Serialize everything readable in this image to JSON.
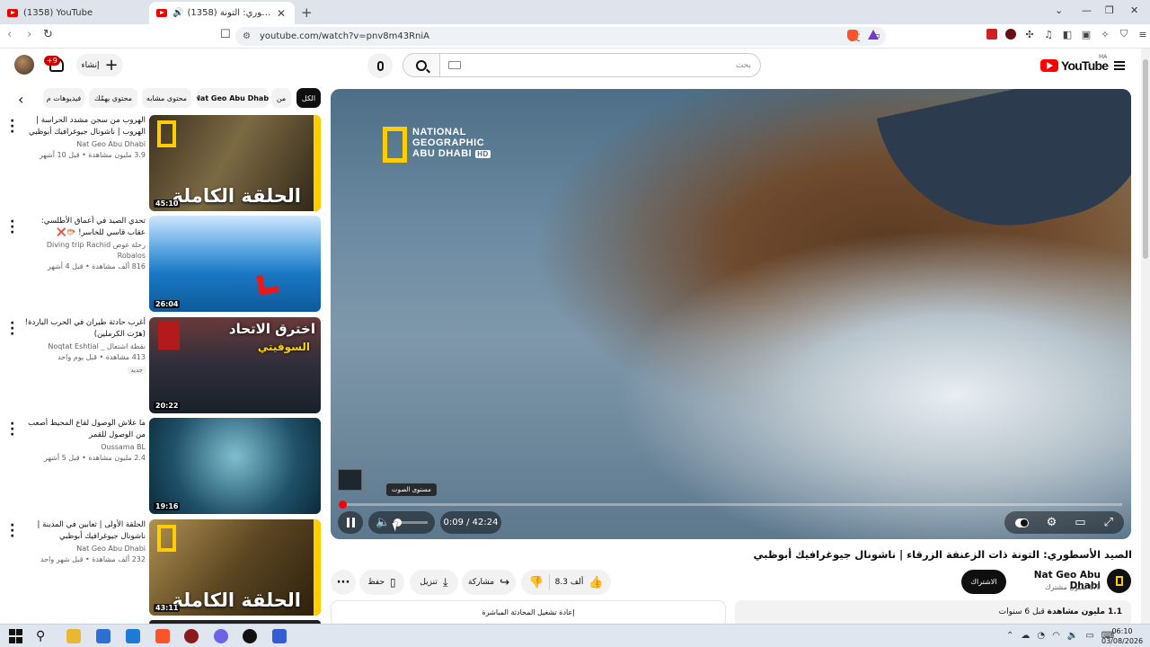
{
  "browser": {
    "tabs": [
      {
        "title": "(1358) YouTube",
        "active": false
      },
      {
        "title": "(1358) الصيد الأسطوري: التونة",
        "active": true
      }
    ],
    "url": "youtube.com/watch?v=pnv8m43RniA"
  },
  "header": {
    "notifications_badge": "+9",
    "create_label": "إنشاء",
    "search_placeholder": "بحث",
    "logo_text": "YouTube",
    "country_code": "MA"
  },
  "chips": [
    {
      "label": "الكل",
      "selected": true
    },
    {
      "label": "من",
      "selected": false
    },
    {
      "label": "Nat Geo Abu Dhabi",
      "selected": false
    },
    {
      "label": "محتوى مشابه",
      "selected": false
    },
    {
      "label": "محتوى يهمّك",
      "selected": false
    },
    {
      "label": "فيديوهات م",
      "selected": false
    }
  ],
  "suggestions": [
    {
      "title": "الهروب من سجن مشدد الحراسة | الهروب | ناشونال جيوغرافيك أبوظبي",
      "channel": "Nat Geo Abu Dhabi",
      "views": "3.9 مليون مشاهدة • قبل 10 أشهر",
      "duration": "45:10",
      "thumb_caption": "الحلقة الكاملة",
      "badge": ""
    },
    {
      "title": "تحدي الصيد في أعماق الأطلسي: عقاب قاسي للخاسر! 🐡❌",
      "channel": "رحلة غوص Diving trip Rachid Robalos",
      "views": "816 ألف مشاهدة • قبل 4 أشهر",
      "duration": "26:04",
      "thumb_caption": "",
      "badge": ""
    },
    {
      "title": "أغرب حادثة طيران في الحرب الباردة! (هرّت الكرملين)",
      "channel": "نقطة اشتعال _ Noqtat Eshtial",
      "views": "413 مشاهدة • قبل يوم واحد",
      "duration": "20:22",
      "thumb_caption": "اخترق الاتحاد",
      "thumb_caption2": "السوفيتي",
      "badge": "جديد"
    },
    {
      "title": "ما علاش الوصول لقاع المحيط أصعب من الوصول للقمر",
      "channel": "Oussama BL",
      "views": "2.4 مليون مشاهدة • قبل 5 أشهر",
      "duration": "19:16",
      "thumb_caption": "",
      "badge": ""
    },
    {
      "title": "الحلقة الأولى | ثعابين في المدينة | ناشونال جيوغرافيك أبوظبي",
      "channel": "Nat Geo Abu Dhabi",
      "views": "232 ألف مشاهدة • قبل شهر واحد",
      "duration": "43:11",
      "thumb_caption": "الحلقة الكاملة",
      "badge": ""
    }
  ],
  "player": {
    "brand_lines": [
      "NATIONAL",
      "GEOGRAPHIC",
      "ABU DHABI"
    ],
    "brand_hd": "HD",
    "tooltip": "مستوى الصوت",
    "time": "0:09 / 42:24",
    "progress_fraction": 0.004,
    "volume_fraction": 0.1
  },
  "video": {
    "title": "الصيد الأسطوري: التونة ذات الزعنفة الزرقاء | ناشونال جيوغرافيك أبوظبي",
    "channel": "Nat Geo Abu Dhabi",
    "subscribers": "6.9 مليون مشترك",
    "subscribe_label": "الاشتراك",
    "likes": "8.3 ألف",
    "share_label": "مشاركة",
    "download_label": "تنزيل",
    "save_label": "حفظ",
    "description_views": "1.1 مليون مشاهدة",
    "description_date": "قبل 6 سنوات",
    "chat_replay": "إعادة تشغيل المحادثة المباشرة"
  },
  "taskbar": {
    "time": "06:10",
    "date": "03/08/2026"
  },
  "colors": {
    "youtube_red": "#ff0000",
    "natgeo_yellow": "#ffce00"
  }
}
